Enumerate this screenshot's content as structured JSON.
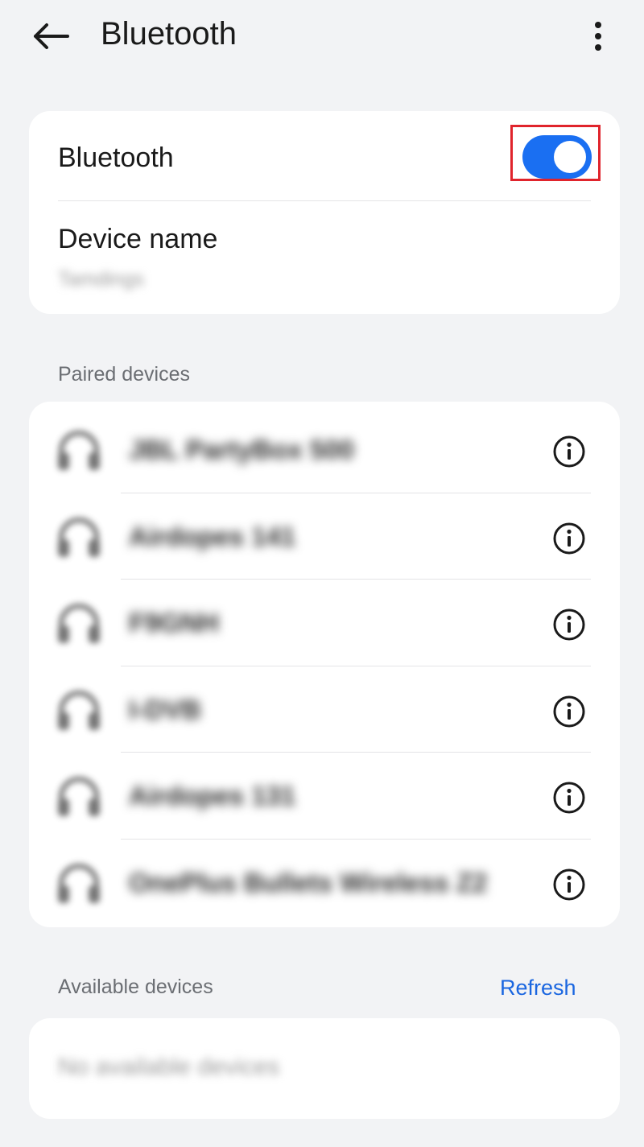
{
  "appbar": {
    "title": "Bluetooth",
    "back_icon": "arrow-left-icon",
    "more_icon": "more-vert-icon"
  },
  "bluetooth_row": {
    "label": "Bluetooth",
    "toggle_state": "on",
    "toggle_color": "#1a6ff2",
    "highlight_color": "#e0242c"
  },
  "device_name_row": {
    "label": "Device name",
    "value": "Tamdings"
  },
  "paired": {
    "header": "Paired devices",
    "devices": [
      {
        "name": "JBL PartyBox 500",
        "icon": "headphones-icon"
      },
      {
        "name": "Airdopes 141",
        "icon": "headphones-icon"
      },
      {
        "name": "F9GNH",
        "icon": "headphones-icon"
      },
      {
        "name": "I-DVB",
        "icon": "headphones-icon"
      },
      {
        "name": "Airdopes 131",
        "icon": "headphones-icon"
      },
      {
        "name": "OnePlus Bullets Wireless Z2",
        "icon": "headphones-icon"
      }
    ],
    "info_icon": "info-icon"
  },
  "available": {
    "header": "Available devices",
    "refresh_label": "Refresh",
    "empty_text": "No available devices",
    "accent_color": "#1a66e0"
  }
}
